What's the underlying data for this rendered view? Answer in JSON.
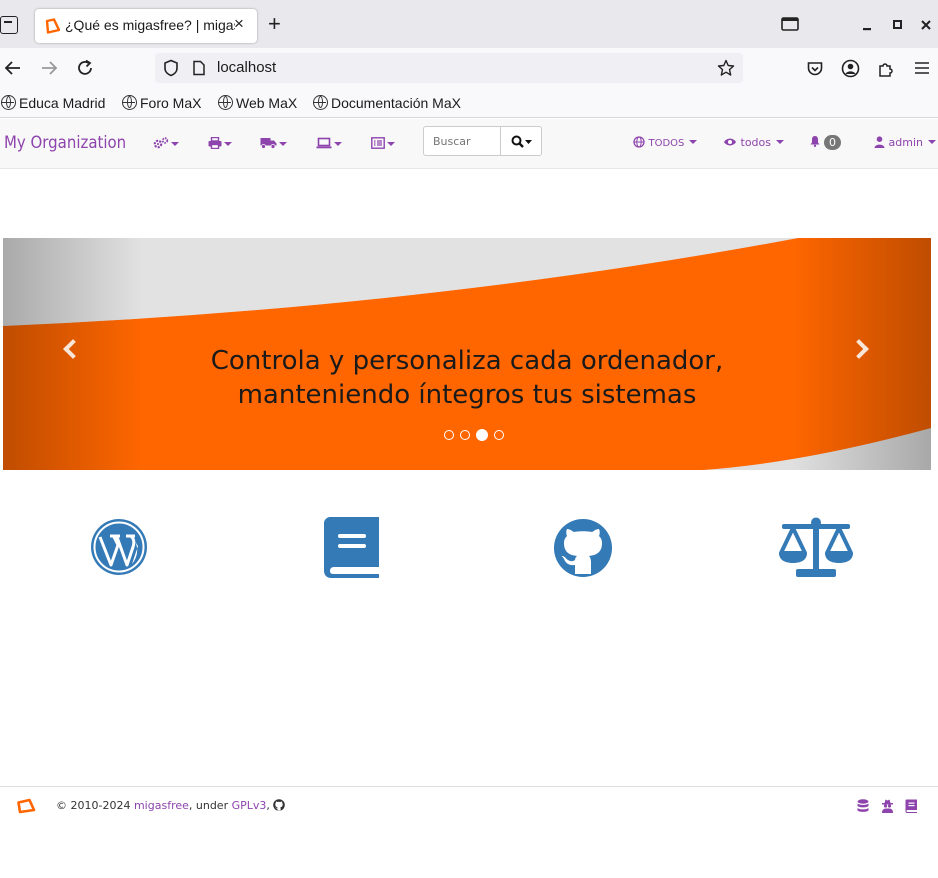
{
  "browser": {
    "tab_title": "¿Qué es migasfree? | migasfree",
    "tab_close": "×",
    "new_tab": "+",
    "url": "localhost",
    "bookmarks": [
      "Educa Madrid",
      "Foro MaX",
      "Web MaX",
      "Documentación MaX"
    ]
  },
  "app": {
    "brand": "My Organization",
    "search_placeholder": "Buscar",
    "scope_label": "TODOS",
    "view_label": "todos",
    "notifications_count": "0",
    "user_label": "admin",
    "accent_color": "#8e44ad",
    "icon_color": "#337ab7",
    "banner_color": "#ff6600"
  },
  "carousel": {
    "caption_line1": "Controla y personaliza cada ordenador,",
    "caption_line2": "manteniendo íntegros tus sistemas",
    "slide_count": 4,
    "active_slide": 3
  },
  "footer": {
    "copyright": "© 2010-2024",
    "project_link": "migasfree",
    "under": ", under",
    "license_link": "GPLv3",
    "comma": ","
  }
}
